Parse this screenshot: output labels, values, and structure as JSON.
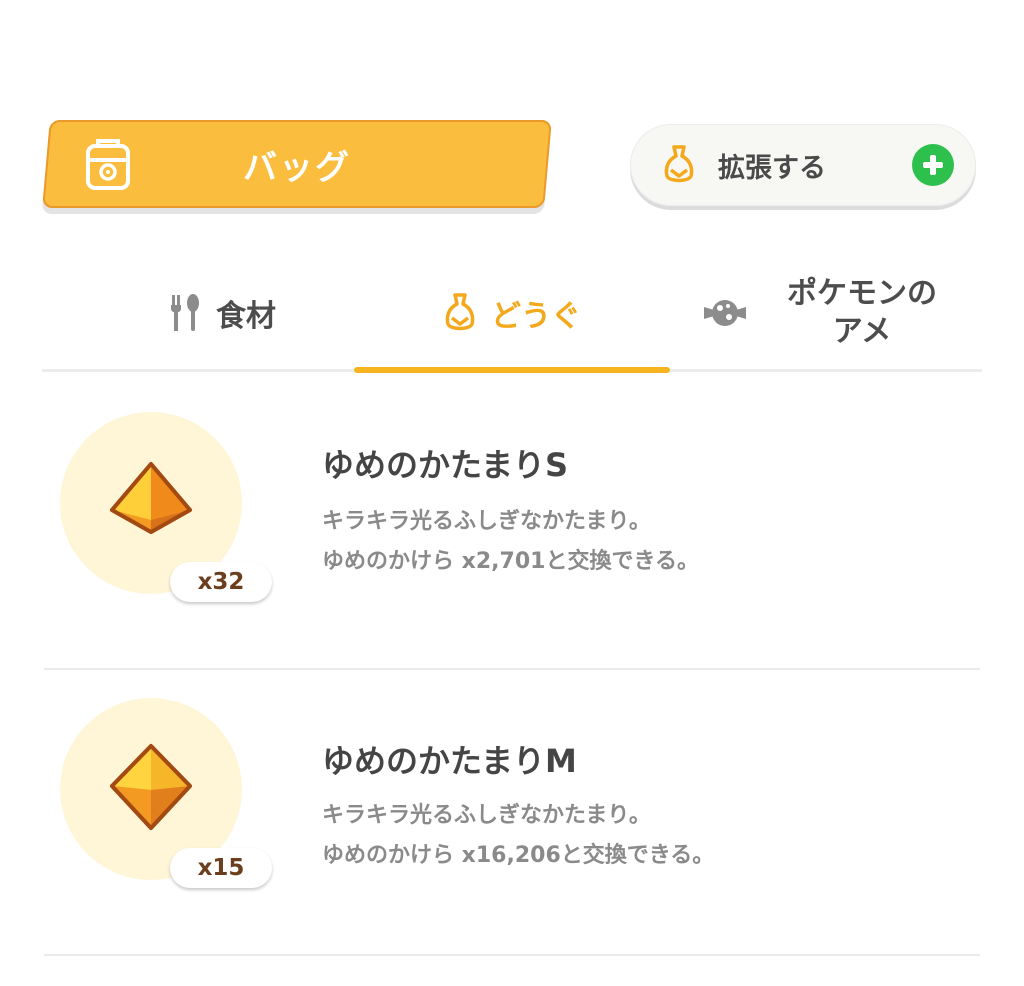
{
  "header": {
    "bag_label": "バッグ",
    "expand_label": "拡張する"
  },
  "tabs": [
    {
      "label": "食材",
      "icon": "fork-spoon-icon",
      "active": false
    },
    {
      "label": "どうぐ",
      "icon": "tool-pouch-icon",
      "active": true
    },
    {
      "label": "ポケモンの\nアメ",
      "icon": "candy-icon",
      "active": false
    }
  ],
  "items": [
    {
      "name": "ゆめのかたまりS",
      "quantity": "x32",
      "desc_line1": "キラキラ光るふしぎなかたまり。",
      "desc_line2": "ゆめのかけら x2,701と交換できる。",
      "icon": "dream-shard-small-icon"
    },
    {
      "name": "ゆめのかたまりM",
      "quantity": "x15",
      "desc_line1": "キラキラ光るふしぎなかたまり。",
      "desc_line2": "ゆめのかけら x16,206と交換できる。",
      "icon": "dream-shard-medium-icon"
    }
  ],
  "colors": {
    "accent": "#f5b420",
    "bag_tab": "#fbbd3e",
    "plus": "#2ec04c"
  }
}
